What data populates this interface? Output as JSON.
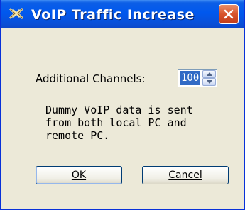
{
  "window": {
    "title": "VoIP Traffic Increase",
    "icon": "app-logo-icon",
    "close_icon": "close-icon"
  },
  "channels": {
    "label": "Additional Channels:",
    "value": "100"
  },
  "description": "Dummy VoIP data is sent\nfrom both local PC and\nremote PC.",
  "buttons": {
    "ok": "OK",
    "cancel": "Cancel"
  },
  "colors": {
    "titlebar": "#0058ee",
    "close": "#d8542c",
    "dialog_bg": "#ece9d8",
    "selection": "#316ac5"
  }
}
